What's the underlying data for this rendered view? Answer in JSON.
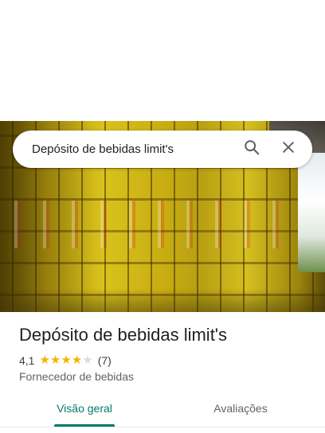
{
  "search": {
    "query": "Depósito de bebidas limit's"
  },
  "place": {
    "name": "Depósito de bebidas limit's",
    "rating": "4,1",
    "rating_value": 4.1,
    "stars_filled": 4,
    "stars_total": 5,
    "review_count": "(7)",
    "category": "Fornecedor de bebidas"
  },
  "tabs": [
    {
      "label": "Visão geral",
      "active": true
    },
    {
      "label": "Avaliações",
      "active": false
    }
  ],
  "colors": {
    "accent": "#00796b",
    "star": "#f4b400",
    "star_empty": "#dadce0"
  },
  "icons": {
    "search": "search-icon",
    "close": "close-icon"
  }
}
